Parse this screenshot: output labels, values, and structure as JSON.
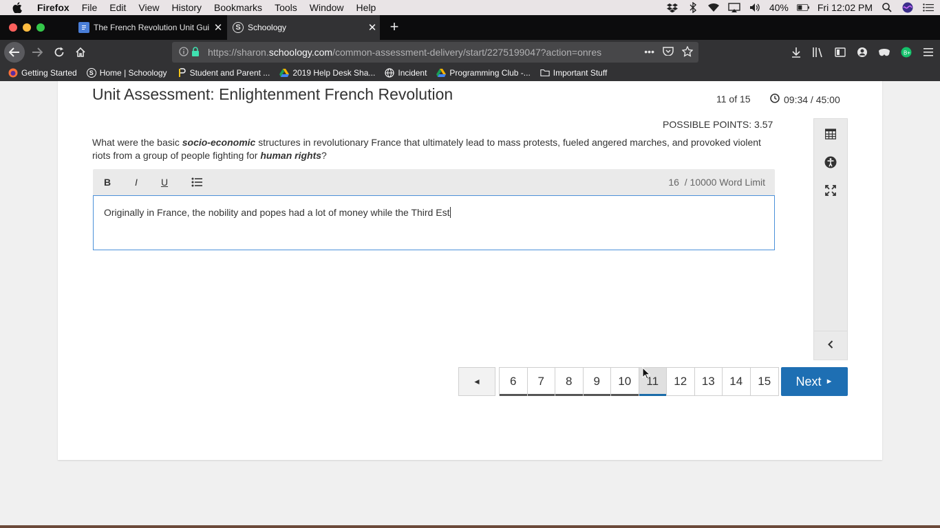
{
  "menubar": {
    "app_name": "Firefox",
    "items": [
      "File",
      "Edit",
      "View",
      "History",
      "Bookmarks",
      "Tools",
      "Window",
      "Help"
    ],
    "battery": "40%",
    "clock": "Fri 12:02 PM"
  },
  "tabs": [
    {
      "title": "The French Revolution Unit Gui",
      "active": false
    },
    {
      "title": "Schoology",
      "active": true
    }
  ],
  "navbar": {
    "url_prefix": "https://sharon.",
    "url_host": "schoology.com",
    "url_path": "/common-assessment-delivery/start/2275199047?action=onres"
  },
  "bookmarks": [
    {
      "label": "Getting Started",
      "icon": "firefox-icon"
    },
    {
      "label": "Home | Schoology",
      "icon": "schoology-icon"
    },
    {
      "label": "Student and Parent ...",
      "icon": "pencil-icon"
    },
    {
      "label": "2019 Help Desk Sha...",
      "icon": "google-drive-icon"
    },
    {
      "label": "Incident",
      "icon": "globe-icon"
    },
    {
      "label": "Programming Club -...",
      "icon": "google-drive-icon"
    },
    {
      "label": "Important Stuff",
      "icon": "folder-icon"
    }
  ],
  "assessment": {
    "title": "Unit Assessment: Enlightenment French Revolution",
    "progress": "11 of 15",
    "timer": "09:34 / 45:00",
    "points": "POSSIBLE POINTS: 3.57",
    "question": {
      "part1": "What were the basic ",
      "emph1": "socio-economic",
      "part2": " structures in revolutionary France that ultimately lead to mass protests, fueled angered marches, and provoked violent riots from a group of people fighting for ",
      "emph2": "human rights",
      "part3": "?"
    },
    "editor": {
      "bold": "B",
      "italic": "I",
      "underline": "U",
      "word_count": "16",
      "word_limit": "/ 10000 Word Limit",
      "text": "Originally in France, the nobility and popes had a lot of money while the Third Est"
    },
    "pager": {
      "prev": "◄",
      "numbers": [
        "6",
        "7",
        "8",
        "9",
        "10",
        "11",
        "12",
        "13",
        "14",
        "15"
      ],
      "current": "11",
      "next": "Next"
    }
  }
}
